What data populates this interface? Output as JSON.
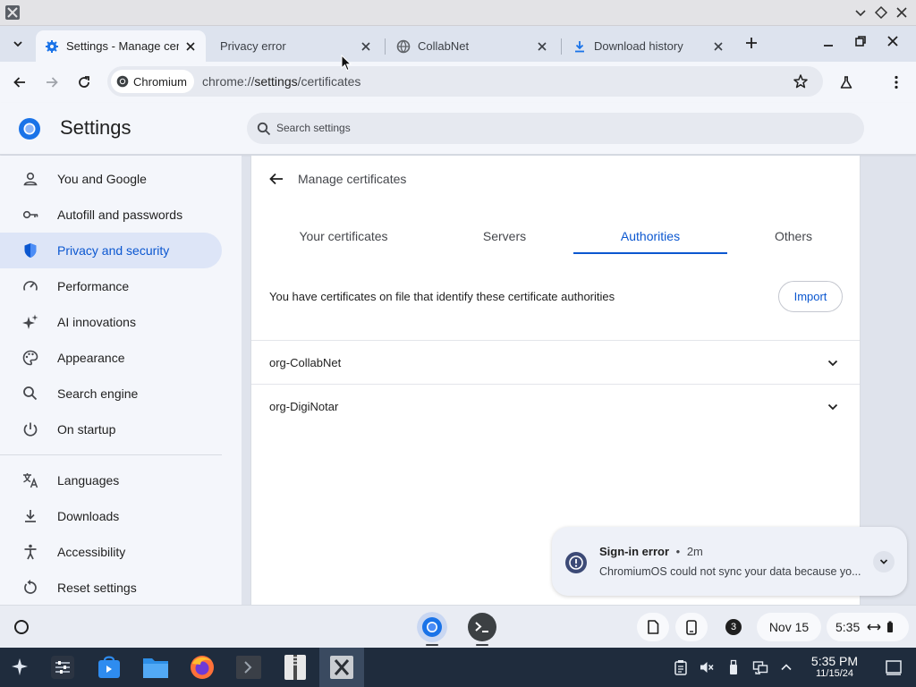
{
  "browser": {
    "tabs": [
      {
        "title": "Settings - Manage certificates",
        "icon": "settings-gear-icon",
        "active": true
      },
      {
        "title": "Privacy error",
        "icon": "",
        "active": false
      },
      {
        "title": "CollabNet",
        "icon": "globe-icon",
        "active": false
      },
      {
        "title": "Download history",
        "icon": "download-icon",
        "active": false
      }
    ],
    "omnibox": {
      "chip_label": "Chromium",
      "url_prefix": "chrome://",
      "url_host": "settings",
      "url_path": "/certificates"
    }
  },
  "settings": {
    "title": "Settings",
    "search_placeholder": "Search settings",
    "nav": [
      {
        "label": "You and Google",
        "icon": "person-icon"
      },
      {
        "label": "Autofill and passwords",
        "icon": "key-icon"
      },
      {
        "label": "Privacy and security",
        "icon": "shield-icon",
        "selected": true
      },
      {
        "label": "Performance",
        "icon": "speedometer-icon"
      },
      {
        "label": "AI innovations",
        "icon": "sparkle-icon"
      },
      {
        "label": "Appearance",
        "icon": "palette-icon"
      },
      {
        "label": "Search engine",
        "icon": "search-icon"
      },
      {
        "label": "On startup",
        "icon": "power-icon"
      },
      {
        "label": "Languages",
        "icon": "translate-icon"
      },
      {
        "label": "Downloads",
        "icon": "download-icon"
      },
      {
        "label": "Accessibility",
        "icon": "accessibility-icon"
      },
      {
        "label": "Reset settings",
        "icon": "reset-icon"
      }
    ],
    "page": {
      "subtitle": "Manage certificates",
      "tabs": [
        "Your certificates",
        "Servers",
        "Authorities",
        "Others"
      ],
      "selected_tab": "Authorities",
      "description": "You have certificates on file that identify these certificate authorities",
      "import_label": "Import",
      "authorities": [
        "org-CollabNet",
        "org-DigiNotar"
      ]
    }
  },
  "notification": {
    "title": "Sign-in error",
    "separator": "•",
    "age": "2m",
    "message": "ChromiumOS could not sync your data because yo..."
  },
  "shelf": {
    "notification_count": "3",
    "date": "Nov 15",
    "time": "5:35"
  },
  "taskbar": {
    "time": "5:35 PM",
    "date": "11/15/24"
  },
  "colors": {
    "accent": "#0b57d0",
    "selected_nav_bg": "#dde5f7",
    "taskbar_bg": "#1f2c3d"
  }
}
